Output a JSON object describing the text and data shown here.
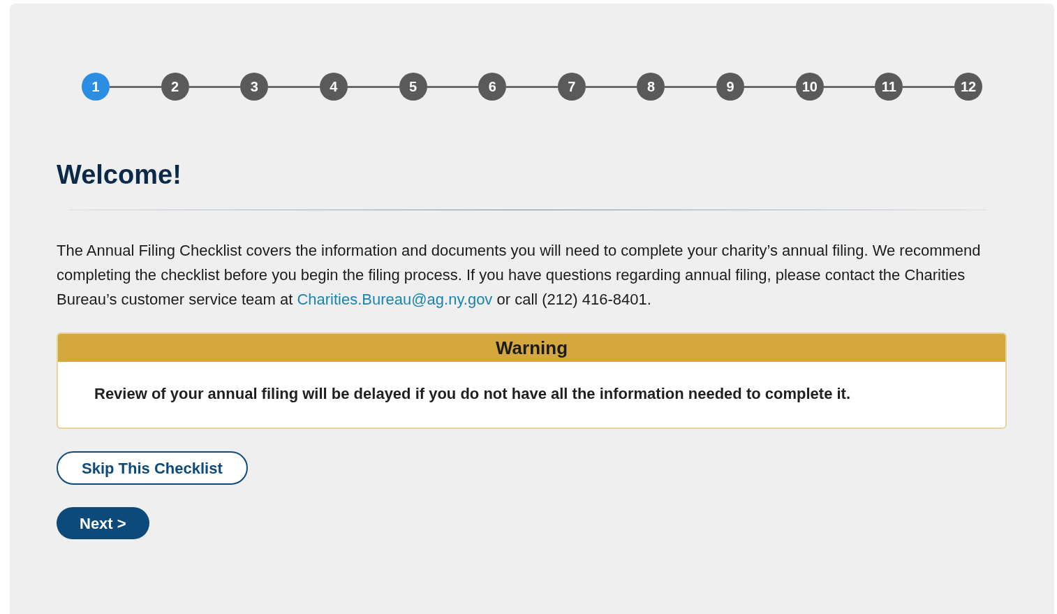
{
  "steps": [
    {
      "label": "1",
      "selected": true
    },
    {
      "label": "2",
      "selected": false
    },
    {
      "label": "3",
      "selected": false
    },
    {
      "label": "4",
      "selected": false
    },
    {
      "label": "5",
      "selected": false
    },
    {
      "label": "6",
      "selected": false
    },
    {
      "label": "7",
      "selected": false
    },
    {
      "label": "8",
      "selected": false
    },
    {
      "label": "9",
      "selected": false
    },
    {
      "label": "10",
      "selected": false
    },
    {
      "label": "11",
      "selected": false
    },
    {
      "label": "12",
      "selected": false
    }
  ],
  "heading": "Welcome!",
  "intro": {
    "text_before": "The Annual Filing Checklist covers the information and documents you will need to complete your charity’s annual filing. We recommend completing the checklist before you begin the filing process. If you have questions regarding annual filing, please contact the Charities Bureau’s customer service team at ",
    "link": "Charities.Bureau@ag.ny.gov",
    "text_after": " or call (212) 416-8401."
  },
  "warning": {
    "title": "Warning",
    "body": "Review of your annual filing will be delayed if you do not have all the information needed to complete it."
  },
  "buttons": [
    {
      "kind": "outline",
      "label": "Skip This Checklist"
    },
    {
      "kind": "primary",
      "label": "Next >"
    }
  ]
}
